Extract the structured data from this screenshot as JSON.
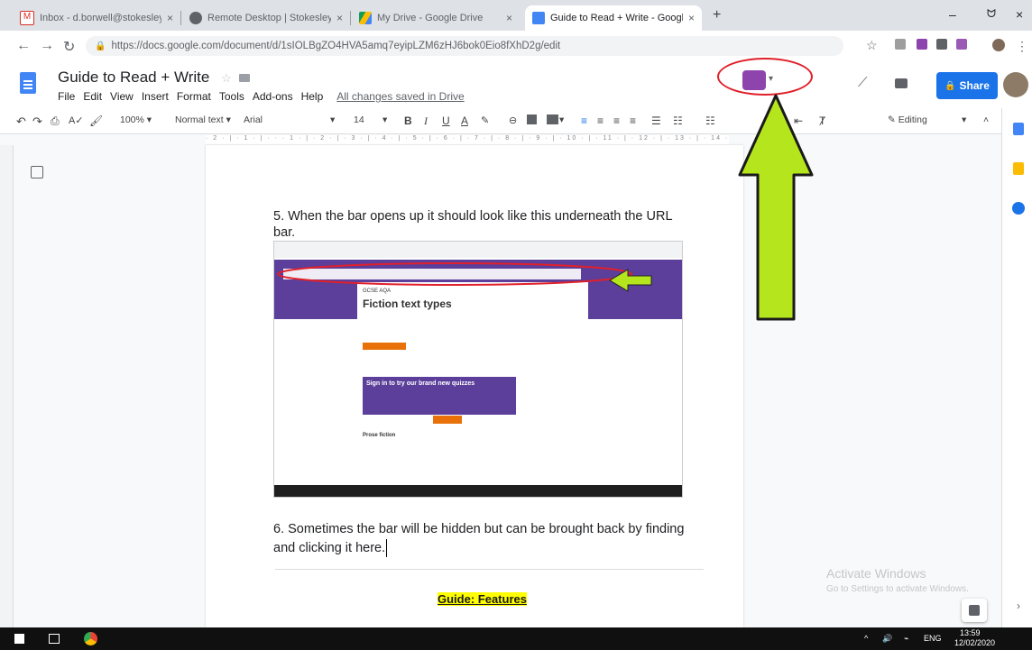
{
  "browser": {
    "tabs": [
      {
        "title": "Inbox - d.borwell@stokesleysch…",
        "icon": "gmail-icon",
        "color": "#d93025"
      },
      {
        "title": "Remote Desktop | Stokesley Sch…",
        "icon": "globe-icon",
        "color": "#5f6368"
      },
      {
        "title": "My Drive - Google Drive",
        "icon": "drive-icon",
        "color": "#fbbc04"
      },
      {
        "title": "Guide to Read + Write - Google…",
        "icon": "docs-icon",
        "color": "#4285f4"
      }
    ],
    "new_tab": "+",
    "url": "https://docs.google.com/document/d/1sIOLBgZO4HVA5amq7eyipLZM6zHJ6bok0Eio8fXhD2g/edit",
    "win_min": "–",
    "win_max": "ᗢ",
    "win_close": "×"
  },
  "docs": {
    "title": "Guide to Read + Write",
    "menu": [
      "File",
      "Edit",
      "View",
      "Insert",
      "Format",
      "Tools",
      "Add-ons",
      "Help"
    ],
    "save_status": "All changes saved in Drive",
    "share_label": "Share",
    "toolbar": {
      "zoom": "100%",
      "style": "Normal text",
      "font": "Arial",
      "size": "14",
      "mode": "Editing"
    },
    "ruler_text": "· 2 · | · 1 · | · · · 1 · | · 2 · | · 3 · | · 4 · | · 5 · | · 6 · | · 7 · | · 8 · | · 9 · | · 10 · | · 11 · | · 12 · | · 13 · | · 14 · | · 15 · | · 16 · | · 17 ·"
  },
  "content": {
    "para5_line1": "5. When the bar opens up it should look like this underneath the URL",
    "para5_line2": "bar.",
    "para6_line1": "6. Sometimes the bar will be hidden but can be brought back by finding",
    "para6_line2": "and clicking it here.",
    "heading": "Guide: Features"
  },
  "embedded": {
    "label": "GCSE AQA",
    "title": "Fiction text types",
    "sign_in": "Sign in to try our brand new quizzes",
    "prose": "Prose fiction"
  },
  "watermark": {
    "line1": "Activate Windows",
    "line2": "Go to Settings to activate Windows."
  },
  "taskbar": {
    "time": "13:59",
    "date": "12/02/2020",
    "lang": "ENG"
  },
  "colors": {
    "accent": "#1a73e8",
    "annotation_red": "#e0202a",
    "arrow_green": "#b5e61d",
    "highlight": "#ffff00",
    "purple": "#5b3f9a"
  }
}
